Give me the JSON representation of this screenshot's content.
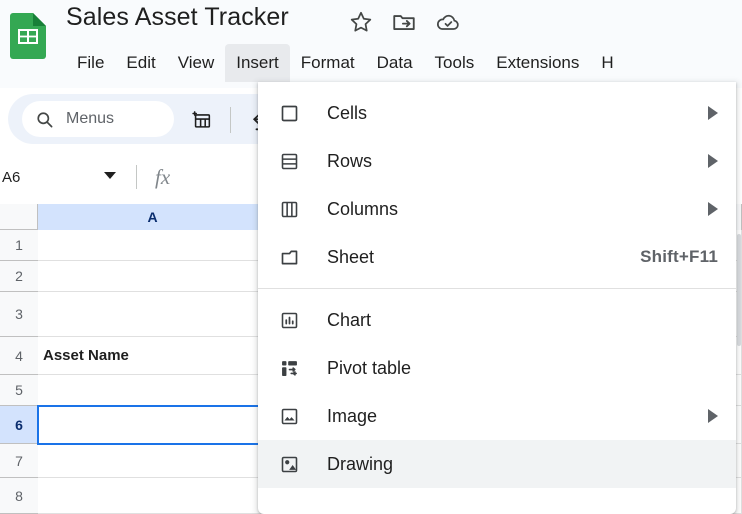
{
  "app": {
    "logo_icon": "google-sheets-logo",
    "title": "Sales Asset Tracker",
    "title_icons": [
      {
        "name": "star-icon",
        "label": "Star"
      },
      {
        "name": "move-to-folder-icon",
        "label": "Move"
      },
      {
        "name": "cloud-saved-icon",
        "label": "Saved to Drive"
      }
    ]
  },
  "menubar": {
    "items": [
      {
        "label": "File",
        "active": false
      },
      {
        "label": "Edit",
        "active": false
      },
      {
        "label": "View",
        "active": false
      },
      {
        "label": "Insert",
        "active": true
      },
      {
        "label": "Format",
        "active": false
      },
      {
        "label": "Data",
        "active": false
      },
      {
        "label": "Tools",
        "active": false
      },
      {
        "label": "Extensions",
        "active": false
      },
      {
        "label": "H",
        "active": false
      }
    ]
  },
  "toolbar": {
    "search_placeholder": "Menus",
    "search_icon": "search-icon",
    "icons": [
      {
        "name": "insert-table-icon"
      },
      {
        "name": "undo-icon"
      }
    ]
  },
  "formula_bar": {
    "name_box_value": "A6",
    "fx_label": "fx"
  },
  "grid": {
    "columns": [
      {
        "label": "A",
        "selected": true
      }
    ],
    "rows": [
      {
        "label": "1",
        "selected": false
      },
      {
        "label": "2",
        "selected": false
      },
      {
        "label": "3",
        "selected": false
      },
      {
        "label": "4",
        "selected": false
      },
      {
        "label": "5",
        "selected": false
      },
      {
        "label": "6",
        "selected": true
      },
      {
        "label": "7",
        "selected": false
      },
      {
        "label": "8",
        "selected": false
      }
    ],
    "cells": [
      {
        "row": "1",
        "col": "A",
        "value": "",
        "bold": false
      },
      {
        "row": "2",
        "col": "A",
        "value": "",
        "bold": false
      },
      {
        "row": "3",
        "col": "A",
        "value": "",
        "bold": false
      },
      {
        "row": "4",
        "col": "A",
        "value": "Asset Name",
        "bold": true
      },
      {
        "row": "5",
        "col": "A",
        "value": "",
        "bold": false
      },
      {
        "row": "6",
        "col": "A",
        "value": "",
        "bold": false
      },
      {
        "row": "7",
        "col": "A",
        "value": "",
        "bold": false
      },
      {
        "row": "8",
        "col": "A",
        "value": "",
        "bold": false
      }
    ],
    "selected_cell": "A6",
    "selection_color": "#1a73e8",
    "header_highlight_color": "#d3e3fd"
  },
  "insert_menu": {
    "groups": [
      {
        "items": [
          {
            "label": "Cells",
            "icon": "cells-icon",
            "submenu": true,
            "shortcut": "",
            "hover": false
          },
          {
            "label": "Rows",
            "icon": "rows-icon",
            "submenu": true,
            "shortcut": "",
            "hover": false
          },
          {
            "label": "Columns",
            "icon": "columns-icon",
            "submenu": true,
            "shortcut": "",
            "hover": false
          },
          {
            "label": "Sheet",
            "icon": "sheet-icon",
            "submenu": false,
            "shortcut": "Shift+F11",
            "hover": false
          }
        ]
      },
      {
        "items": [
          {
            "label": "Chart",
            "icon": "chart-icon",
            "submenu": false,
            "shortcut": "",
            "hover": false
          },
          {
            "label": "Pivot table",
            "icon": "pivot-table-icon",
            "submenu": false,
            "shortcut": "",
            "hover": false
          },
          {
            "label": "Image",
            "icon": "image-icon",
            "submenu": true,
            "shortcut": "",
            "hover": false
          },
          {
            "label": "Drawing",
            "icon": "drawing-icon",
            "submenu": false,
            "shortcut": "",
            "hover": true
          }
        ]
      }
    ]
  }
}
